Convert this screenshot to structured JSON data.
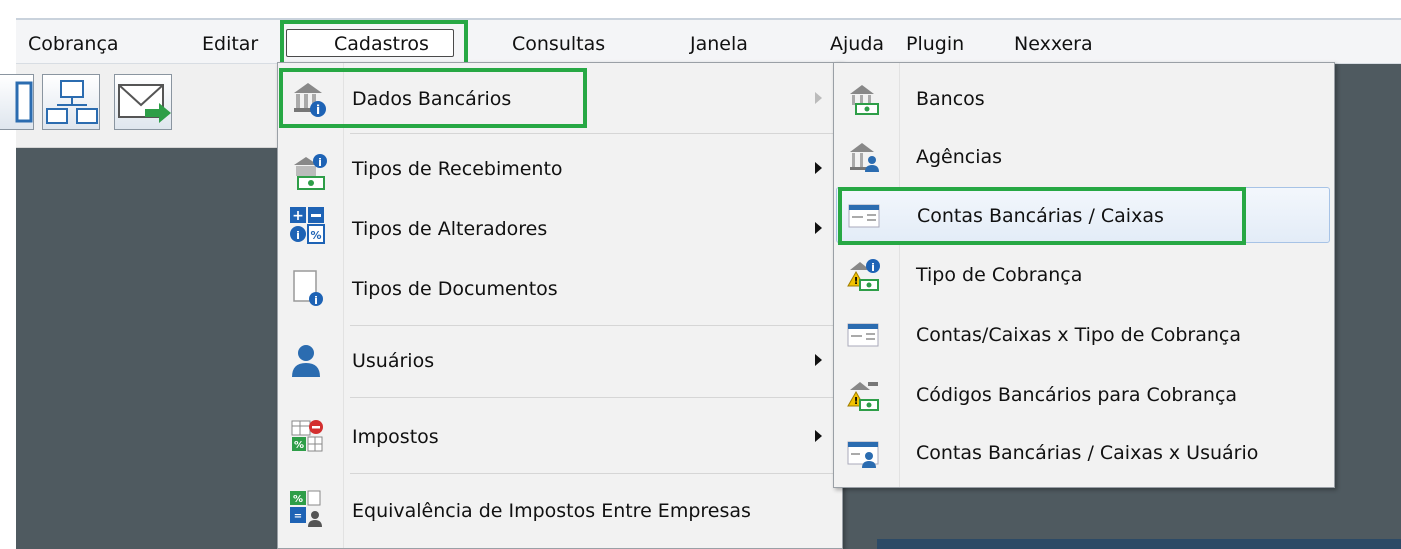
{
  "menubar": {
    "items": [
      "Cobrança",
      "Editar",
      "Cadastros",
      "Consultas",
      "Janela",
      "Ajuda",
      "Plugin",
      "Nexxera"
    ]
  },
  "toolbar": {
    "icons": [
      "window-icon",
      "network-icon",
      "mail-send-icon"
    ]
  },
  "cadastros_menu": {
    "items": [
      {
        "label": "Dados Bancários",
        "submenu": true,
        "icon": "bank-info-icon"
      },
      {
        "label": "Tipos de Recebimento",
        "submenu": true,
        "icon": "receipt-type-icon"
      },
      {
        "label": "Tipos de Alteradores",
        "submenu": true,
        "icon": "plus-minus-percent-icon"
      },
      {
        "label": "Tipos de Documentos",
        "submenu": false,
        "icon": "document-info-icon"
      },
      {
        "label": "Usuários",
        "submenu": true,
        "icon": "user-icon"
      },
      {
        "label": "Impostos",
        "submenu": true,
        "icon": "tax-icon"
      },
      {
        "label": "Equivalência de Impostos Entre Empresas",
        "submenu": false,
        "icon": "tax-equivalence-icon"
      }
    ]
  },
  "dados_bancarios_menu": {
    "items": [
      {
        "label": "Bancos",
        "icon": "bank-icon"
      },
      {
        "label": "Agências",
        "icon": "agency-icon"
      },
      {
        "label": "Contas Bancárias / Caixas",
        "icon": "bank-account-icon",
        "highlighted": true
      },
      {
        "label": "Tipo de Cobrança",
        "icon": "billing-type-icon"
      },
      {
        "label": "Contas/Caixas x Tipo de Cobrança",
        "icon": "account-billing-icon"
      },
      {
        "label": "Códigos Bancários para Cobrança",
        "icon": "bank-codes-icon"
      },
      {
        "label": "Contas Bancárias / Caixas x Usuário",
        "icon": "account-user-icon"
      }
    ]
  },
  "colors": {
    "highlight_box": "#27a844",
    "background": "#4f5a60"
  }
}
